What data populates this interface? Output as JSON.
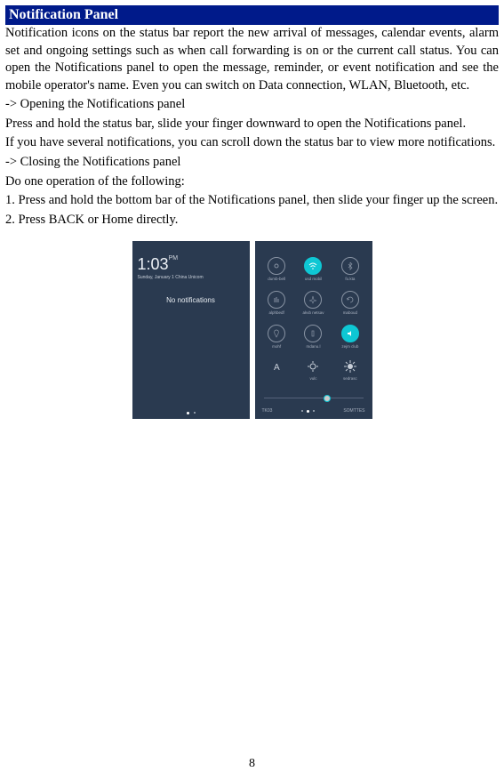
{
  "header": {
    "title": "Notification Panel"
  },
  "body": {
    "intro": "Notification icons on the status bar report the new arrival of messages, calendar events, alarm set and ongoing settings such as when call forwarding is on or the current call status. You can open the Notifications panel to open the message, reminder, or event notification and see the mobile operator's name. Even you can switch on Data connection, WLAN, Bluetooth, etc.",
    "open_heading": "-> Opening the Notifications panel",
    "open_step1": "Press and hold the status bar, slide your finger downward to open the Notifications panel.",
    "open_step2": "If you have several notifications, you can scroll down the status bar to view more notifications.",
    "close_heading": "-> Closing the Notifications panel",
    "close_intro": "Do one operation of the following:",
    "close_step1": "1. Press and hold the bottom bar of the Notifications panel, then slide your finger up the screen.",
    "close_step2": "2. Press BACK or Home directly."
  },
  "phone_left": {
    "time": "1:03",
    "ampm": "PM",
    "date": "Sunday, January 1  China Unicom",
    "no_notifications": "No notifications"
  },
  "phone_right": {
    "tiles": [
      {
        "label": "dumb-bell",
        "active": false
      },
      {
        "label": "usd mobil",
        "active": true
      },
      {
        "label": "fo.kta",
        "active": false
      },
      {
        "label": "alphbedf",
        "active": false
      },
      {
        "label": "akvb netsav",
        "active": false
      },
      {
        "label": "maboud",
        "active": false
      },
      {
        "label": "mohf",
        "active": false
      },
      {
        "label": "mdanu.l",
        "active": false
      },
      {
        "label": "zejm club",
        "active": true
      }
    ],
    "controls": [
      {
        "label": ""
      },
      {
        "label": "vulc"
      },
      {
        "label": "sedrasc"
      }
    ],
    "footer_left": "TK03",
    "footer_right": "SOMTTES"
  },
  "page_number": "8"
}
